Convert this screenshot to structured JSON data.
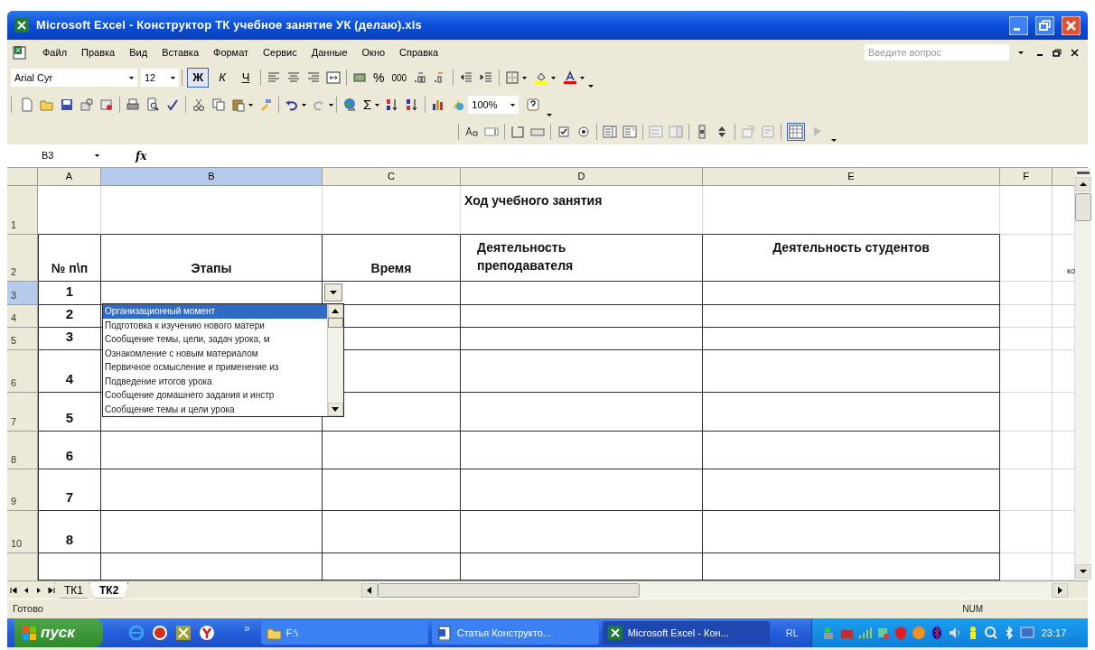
{
  "window": {
    "title": "Microsoft Excel - Конструктор ТК учебное занятие УК (делаю).xls"
  },
  "menu": [
    {
      "label": "Файл"
    },
    {
      "label": "Правка"
    },
    {
      "label": "Вид"
    },
    {
      "label": "Вставка"
    },
    {
      "label": "Формат"
    },
    {
      "label": "Сервис"
    },
    {
      "label": "Данные"
    },
    {
      "label": "Окно"
    },
    {
      "label": "Справка"
    }
  ],
  "help_box": {
    "placeholder": "Введите вопрос"
  },
  "format_toolbar": {
    "font": "Arial Cyr",
    "size": "12",
    "bold": {
      "label": "Ж",
      "selected": true
    },
    "italic": "К",
    "underline": "Ч",
    "percent": "%",
    "thousands": "000"
  },
  "standard_toolbar": {
    "sum": "Σ",
    "zoom": "100%"
  },
  "formula_bar": {
    "cell": "B3",
    "fx": "fx"
  },
  "columns": [
    {
      "label": "A",
      "selected": false
    },
    {
      "label": "B",
      "selected": true
    },
    {
      "label": "C",
      "selected": false
    },
    {
      "label": "D",
      "selected": false
    },
    {
      "label": "E",
      "selected": false
    },
    {
      "label": "F",
      "selected": false
    }
  ],
  "rows": [
    {
      "label": "1",
      "selected": false,
      "d": "Ход учебного занятия"
    },
    {
      "label": "2",
      "selected": false,
      "a": "№ п\\п",
      "b": "Этапы",
      "c": "Время",
      "d": "Деятельность преподавателя",
      "e": "Деятельность студентов",
      "g": "ко"
    },
    {
      "label": "3",
      "selected": true,
      "a": "1"
    },
    {
      "label": "4",
      "selected": false,
      "a": "2"
    },
    {
      "label": "5",
      "selected": false,
      "a": "3"
    },
    {
      "label": "6",
      "selected": false,
      "a": "4"
    },
    {
      "label": "7",
      "selected": false,
      "a": "5"
    },
    {
      "label": "8",
      "selected": false,
      "a": "6"
    },
    {
      "label": "9",
      "selected": false,
      "a": "7"
    },
    {
      "label": "10",
      "selected": false,
      "a": "8"
    }
  ],
  "dropdown": {
    "items": [
      {
        "text": "Организационный момент",
        "selected": true
      },
      {
        "text": "Подготовка к изучению нового матери",
        "selected": false
      },
      {
        "text": "Сообщение темы, цели, задач урока, м",
        "selected": false
      },
      {
        "text": "Ознакомление с новым материалом",
        "selected": false
      },
      {
        "text": "Первичное осмысление и применение из",
        "selected": false
      },
      {
        "text": "Подведение итогов урока",
        "selected": false
      },
      {
        "text": "Сообщение домашнего задания и инстр",
        "selected": false
      },
      {
        "text": "Сообщение темы и цели урока",
        "selected": false
      }
    ]
  },
  "sheet_tabs": [
    {
      "label": "ТК1",
      "selected": false
    },
    {
      "label": "ТК2",
      "selected": true
    }
  ],
  "status_bar": {
    "text": "Готово",
    "indicator": "NUM"
  },
  "taskbar": {
    "start": "пуск",
    "overflow": "»",
    "tasks": [
      {
        "label": "F:\\",
        "selected": false
      },
      {
        "label": "Статья Конструкто...",
        "selected": false
      },
      {
        "label": "Microsoft Excel - Кон...",
        "selected": true
      }
    ],
    "language": "RL",
    "clock": "23:17"
  }
}
